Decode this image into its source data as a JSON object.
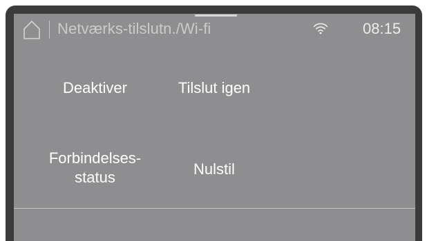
{
  "header": {
    "title": "Netværks-tilslutn./Wi-fi",
    "time": "08:15",
    "home_icon": "home-icon",
    "wifi_icon": "wifi-icon"
  },
  "menu": {
    "items": [
      {
        "id": "deactivate",
        "label": "Deaktiver"
      },
      {
        "id": "reconnect",
        "label": "Tilslut igen"
      },
      {
        "id": "connection-status",
        "line1": "Forbindelses-",
        "line2": "status"
      },
      {
        "id": "reset",
        "label": "Nulstil"
      }
    ]
  },
  "colors": {
    "screen_bg": "#8e8e90",
    "bezel": "#3b3b3b",
    "text_primary": "#ffffff",
    "text_dim": "#cbcbcb"
  }
}
